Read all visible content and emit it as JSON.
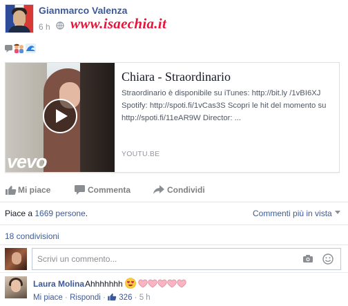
{
  "post": {
    "author": "Gianmarco Valenza",
    "time": "6 h",
    "audience_icon": "globe-icon",
    "watermark": "www.isaechia.it",
    "reaction_icons": [
      "speech-bubble-icon",
      "couple-emoji-icon",
      "wave-emoji-icon"
    ]
  },
  "link_card": {
    "title": "Chiara - Straordinario",
    "description": "Straordinario è disponibile su iTunes: http://bit.ly /1vBI6XJ Spotify: http://spoti.fi/1vCas3S Scopri le hit del momento su http://spoti.fi/11eAR9W Director: ...",
    "source": "YOUTU.BE",
    "video_brand": "vevo"
  },
  "actions": {
    "like": "Mi piace",
    "comment": "Commenta",
    "share": "Condividi"
  },
  "likes_summary": {
    "prefix": "Piace a",
    "count": "1669 persone",
    "suffix": "."
  },
  "comments_sort": "Commenti più in vista",
  "shares": "18 condivisioni",
  "composer": {
    "placeholder": "Scrivi un commento..."
  },
  "comment": {
    "author": "Laura Molina",
    "text": "Ahhhhhhh",
    "emojis": [
      "heart-eyes-emoji",
      "heart",
      "heart",
      "heart",
      "heart",
      "heart"
    ],
    "like_label": "Mi piace",
    "reply_label": "Rispondi",
    "like_count": "326",
    "separator": "·",
    "time": "5 h"
  },
  "colors": {
    "link_blue": "#3b5998",
    "muted_gray": "#9197a3",
    "watermark_red": "#e5143a",
    "heart_pink": "#f7b6c2"
  }
}
